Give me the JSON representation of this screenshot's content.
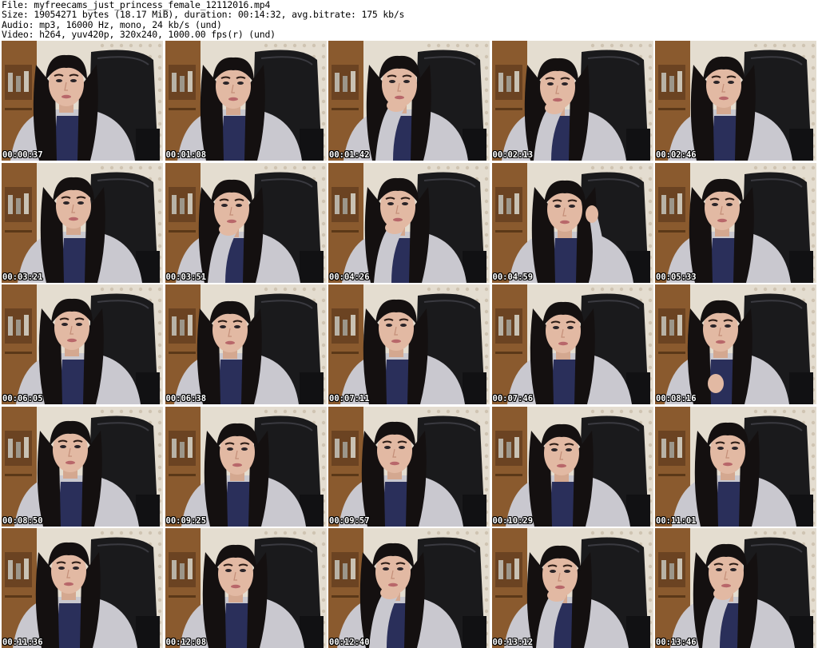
{
  "header": {
    "file_line": "File: myfreecams_just_princess_female_12112016.mp4",
    "size_line": "Size: 19054271 bytes (18.17 MiB), duration: 00:14:32, avg.bitrate: 175 kb/s",
    "audio_line": "Audio: mp3, 16000 Hz, mono, 24 kb/s (und)",
    "video_line": "Video: h264, yuv420p, 320x240, 1000.00 fps(r) (und)"
  },
  "thumbnails": [
    {
      "timestamp": "00:00:37",
      "pose": "neutral"
    },
    {
      "timestamp": "00:01:08",
      "pose": "neutral"
    },
    {
      "timestamp": "00:01:42",
      "pose": "hand-chin"
    },
    {
      "timestamp": "00:02:13",
      "pose": "hand-chin"
    },
    {
      "timestamp": "00:02:46",
      "pose": "neutral"
    },
    {
      "timestamp": "00:03:21",
      "pose": "neutral"
    },
    {
      "timestamp": "00:03:51",
      "pose": "hand-chin"
    },
    {
      "timestamp": "00:04:26",
      "pose": "hand-chin"
    },
    {
      "timestamp": "00:04:59",
      "pose": "hand-hair"
    },
    {
      "timestamp": "00:05:33",
      "pose": "neutral"
    },
    {
      "timestamp": "00:06:05",
      "pose": "neutral"
    },
    {
      "timestamp": "00:06:38",
      "pose": "neutral"
    },
    {
      "timestamp": "00:07:11",
      "pose": "neutral"
    },
    {
      "timestamp": "00:07:46",
      "pose": "neutral"
    },
    {
      "timestamp": "00:08:16",
      "pose": "hand-up"
    },
    {
      "timestamp": "00:08:50",
      "pose": "neutral"
    },
    {
      "timestamp": "00:09:25",
      "pose": "neutral"
    },
    {
      "timestamp": "00:09:57",
      "pose": "neutral"
    },
    {
      "timestamp": "00:10:29",
      "pose": "neutral"
    },
    {
      "timestamp": "00:11:01",
      "pose": "neutral"
    },
    {
      "timestamp": "00:11:36",
      "pose": "neutral"
    },
    {
      "timestamp": "00:12:08",
      "pose": "neutral"
    },
    {
      "timestamp": "00:12:40",
      "pose": "hand-chin"
    },
    {
      "timestamp": "00:13:12",
      "pose": "hand-chin"
    },
    {
      "timestamp": "00:13:46",
      "pose": "hand-chin"
    }
  ],
  "colors": {
    "page_background": "#ffffff",
    "header_text": "#000000",
    "timestamp_text": "#ffffff",
    "timestamp_outline": "#000000",
    "wall": "#e4ddd0",
    "cabinet": "#8a5a2e",
    "chair": "#1a1a1c",
    "hair": "#141010",
    "skin": "#e2b9a3",
    "sweater": "#c9c8cf",
    "shirt": "#2a2f5a"
  }
}
